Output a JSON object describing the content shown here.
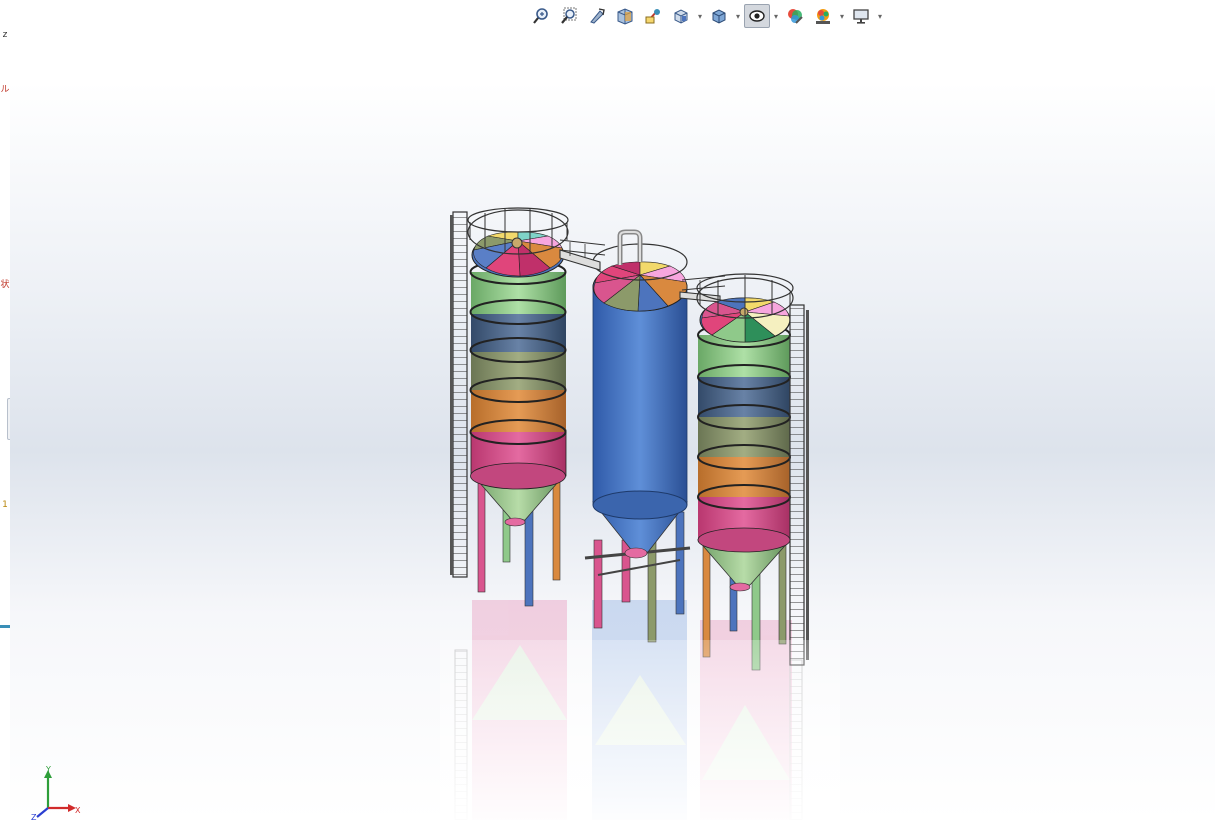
{
  "toolbar": {
    "items": [
      {
        "name": "zoom-to-fit-icon"
      },
      {
        "name": "zoom-to-area-icon"
      },
      {
        "name": "previous-view-icon"
      },
      {
        "name": "section-view-icon"
      },
      {
        "name": "dynamic-annotation-icon"
      },
      {
        "name": "view-orientation-icon",
        "dropdown": true
      },
      {
        "name": "display-style-icon",
        "dropdown": true
      },
      {
        "name": "hide-show-items-icon",
        "dropdown": true,
        "active": true
      },
      {
        "name": "edit-appearance-icon"
      },
      {
        "name": "apply-scene-icon",
        "dropdown": true
      },
      {
        "name": "view-settings-icon",
        "dropdown": true
      }
    ]
  },
  "triad": {
    "x_label": "X",
    "y_label": "Y",
    "z_label": "Z"
  },
  "colors": {
    "pink": "#d9558e",
    "orange": "#d9893f",
    "olive": "#8c9a6a",
    "slate": "#4d6788",
    "green": "#8fc98a",
    "blue": "#4d74bd",
    "steel": "#4a4a4a"
  }
}
